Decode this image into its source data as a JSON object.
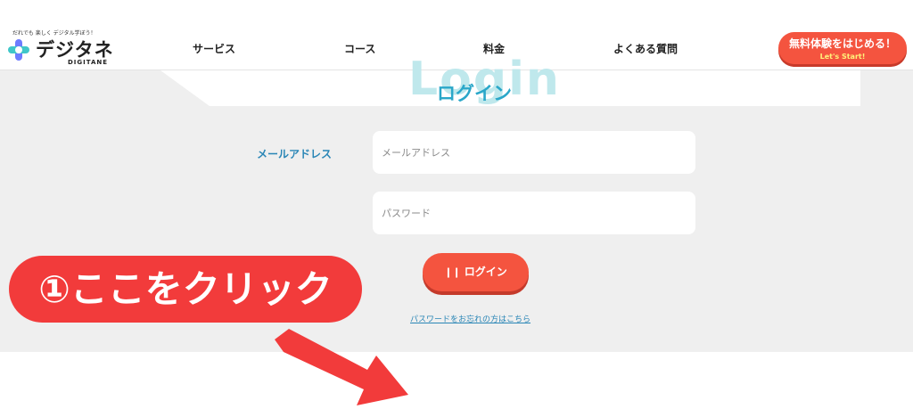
{
  "header": {
    "logo_tagline": "だれでも 楽しく デジタル学ぼう！",
    "logo_name": "デジタネ",
    "logo_sub": "DIGITANE",
    "nav": [
      "サービス",
      "コース",
      "料金",
      "よくある質問"
    ],
    "cta_main": "無料体験をはじめる！",
    "cta_sub": "Let's Start!"
  },
  "login": {
    "ghost_text": "Login",
    "title": "ログイン",
    "email_label": "メールアドレス",
    "email_placeholder": "メールアドレス",
    "password_placeholder": "パスワード",
    "button_label": "ログイン",
    "forgot_link": "パスワードをお忘れの方はこちら"
  },
  "annotation": {
    "callout": "①ここをクリック"
  },
  "colors": {
    "accent": "#f4543f",
    "title": "#2aa7c9",
    "label": "#2a86b6",
    "callout": "#f23b3b",
    "background": "#efefef"
  }
}
